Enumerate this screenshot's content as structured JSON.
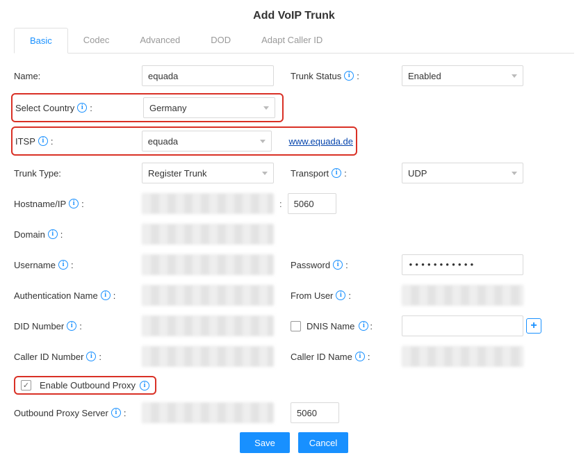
{
  "title": "Add VoIP Trunk",
  "tabs": [
    "Basic",
    "Codec",
    "Advanced",
    "DOD",
    "Adapt Caller ID"
  ],
  "labels": {
    "name": "Name:",
    "trunkStatus": "Trunk Status",
    "selectCountry": "Select Country",
    "itsp": "ITSP",
    "trunkType": "Trunk Type:",
    "transport": "Transport",
    "hostname": "Hostname/IP",
    "domain": "Domain",
    "username": "Username",
    "password": "Password",
    "authName": "Authentication Name",
    "fromUser": "From User",
    "did": "DID Number",
    "dnis": "DNIS Name",
    "callerIdNum": "Caller ID Number",
    "callerIdName": "Caller ID Name",
    "enableOutboundProxy": "Enable Outbound Proxy",
    "outboundProxy": "Outbound Proxy Server"
  },
  "values": {
    "name": "equada",
    "trunkStatus": "Enabled",
    "selectCountry": "Germany",
    "itsp": "equada",
    "itspLink": "www.equada.de",
    "trunkType": "Register Trunk",
    "transport": "UDP",
    "port": "5060",
    "password": "•••••••••••",
    "outboundPort": "5060",
    "dnisChecked": false,
    "outboundProxyChecked": true
  },
  "buttons": {
    "save": "Save",
    "cancel": "Cancel"
  },
  "colon": ":"
}
